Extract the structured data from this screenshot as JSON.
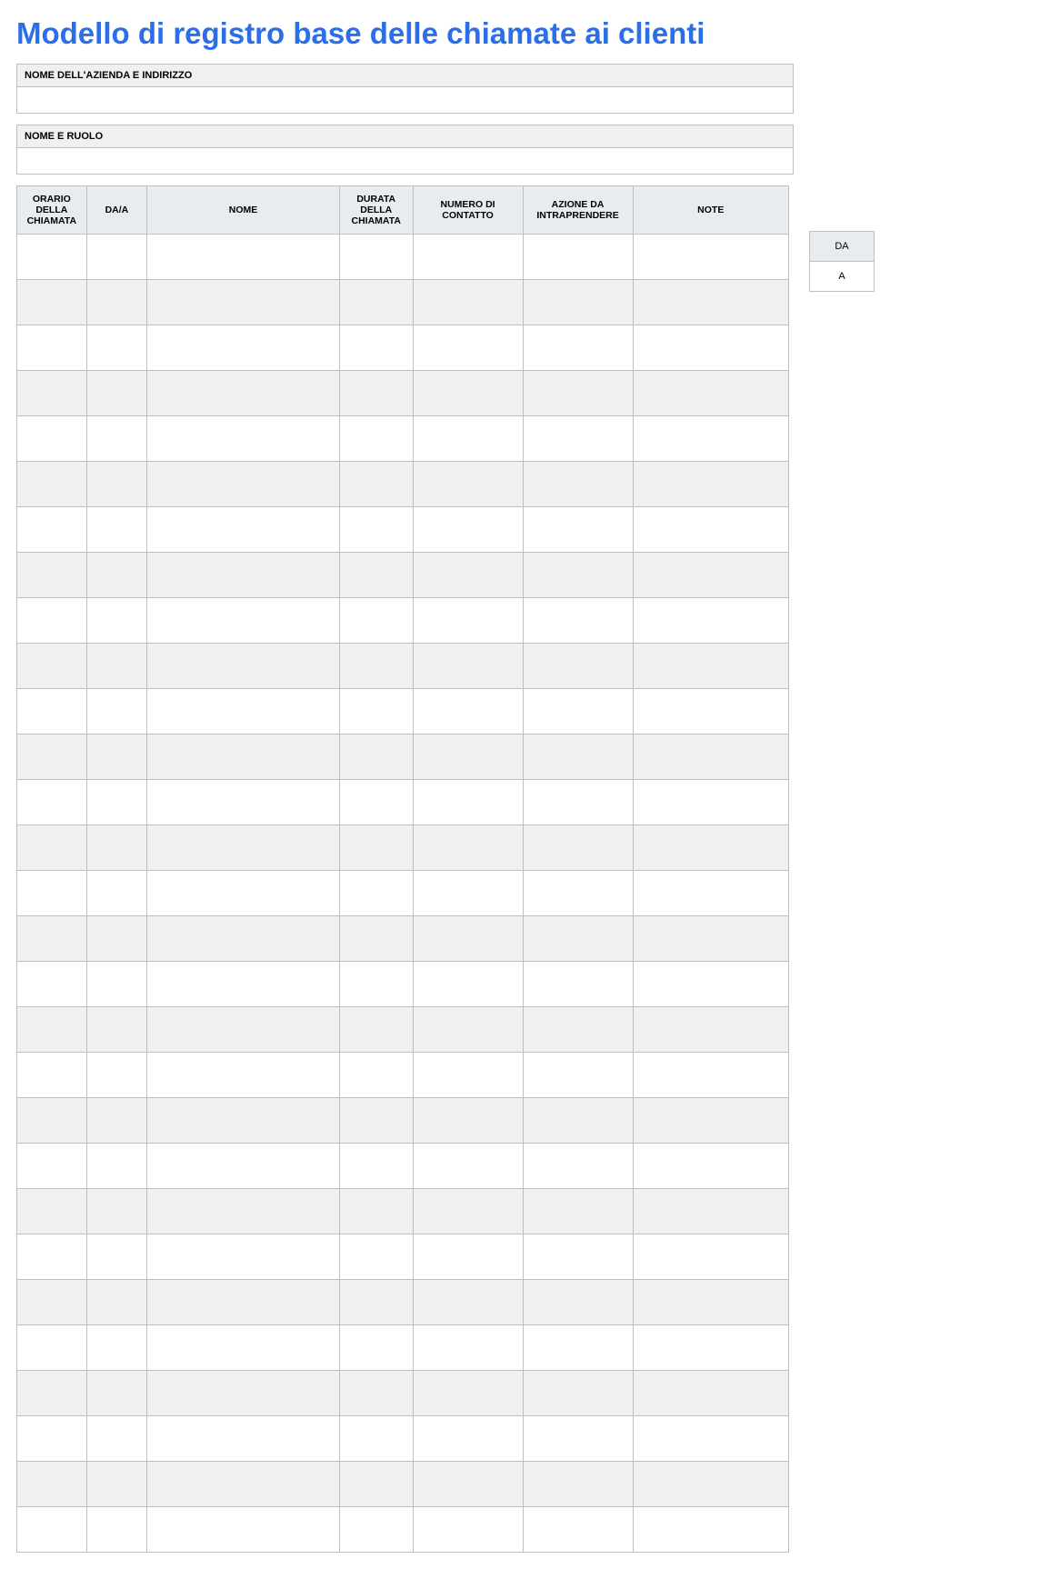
{
  "title": "Modello di registro base delle chiamate ai clienti",
  "info": {
    "company_label": "NOME DELL'AZIENDA E INDIRIZZO",
    "company_value": "",
    "name_role_label": "NOME E RUOLO",
    "name_role_value": ""
  },
  "columns": {
    "time": "ORARIO DELLA CHIAMATA",
    "daa": "DA/A",
    "name": "NOME",
    "dur": "DURATA DELLA CHIAMATA",
    "contact": "NUMERO DI CONTATTO",
    "action": "AZIONE DA INTRAPRENDERE",
    "note": "NOTE"
  },
  "rows": [
    {
      "time": "",
      "daa": "",
      "name": "",
      "dur": "",
      "contact": "",
      "action": "",
      "note": ""
    },
    {
      "time": "",
      "daa": "",
      "name": "",
      "dur": "",
      "contact": "",
      "action": "",
      "note": ""
    },
    {
      "time": "",
      "daa": "",
      "name": "",
      "dur": "",
      "contact": "",
      "action": "",
      "note": ""
    },
    {
      "time": "",
      "daa": "",
      "name": "",
      "dur": "",
      "contact": "",
      "action": "",
      "note": ""
    },
    {
      "time": "",
      "daa": "",
      "name": "",
      "dur": "",
      "contact": "",
      "action": "",
      "note": ""
    },
    {
      "time": "",
      "daa": "",
      "name": "",
      "dur": "",
      "contact": "",
      "action": "",
      "note": ""
    },
    {
      "time": "",
      "daa": "",
      "name": "",
      "dur": "",
      "contact": "",
      "action": "",
      "note": ""
    },
    {
      "time": "",
      "daa": "",
      "name": "",
      "dur": "",
      "contact": "",
      "action": "",
      "note": ""
    },
    {
      "time": "",
      "daa": "",
      "name": "",
      "dur": "",
      "contact": "",
      "action": "",
      "note": ""
    },
    {
      "time": "",
      "daa": "",
      "name": "",
      "dur": "",
      "contact": "",
      "action": "",
      "note": ""
    },
    {
      "time": "",
      "daa": "",
      "name": "",
      "dur": "",
      "contact": "",
      "action": "",
      "note": ""
    },
    {
      "time": "",
      "daa": "",
      "name": "",
      "dur": "",
      "contact": "",
      "action": "",
      "note": ""
    },
    {
      "time": "",
      "daa": "",
      "name": "",
      "dur": "",
      "contact": "",
      "action": "",
      "note": ""
    },
    {
      "time": "",
      "daa": "",
      "name": "",
      "dur": "",
      "contact": "",
      "action": "",
      "note": ""
    },
    {
      "time": "",
      "daa": "",
      "name": "",
      "dur": "",
      "contact": "",
      "action": "",
      "note": ""
    },
    {
      "time": "",
      "daa": "",
      "name": "",
      "dur": "",
      "contact": "",
      "action": "",
      "note": ""
    },
    {
      "time": "",
      "daa": "",
      "name": "",
      "dur": "",
      "contact": "",
      "action": "",
      "note": ""
    },
    {
      "time": "",
      "daa": "",
      "name": "",
      "dur": "",
      "contact": "",
      "action": "",
      "note": ""
    },
    {
      "time": "",
      "daa": "",
      "name": "",
      "dur": "",
      "contact": "",
      "action": "",
      "note": ""
    },
    {
      "time": "",
      "daa": "",
      "name": "",
      "dur": "",
      "contact": "",
      "action": "",
      "note": ""
    },
    {
      "time": "",
      "daa": "",
      "name": "",
      "dur": "",
      "contact": "",
      "action": "",
      "note": ""
    },
    {
      "time": "",
      "daa": "",
      "name": "",
      "dur": "",
      "contact": "",
      "action": "",
      "note": ""
    },
    {
      "time": "",
      "daa": "",
      "name": "",
      "dur": "",
      "contact": "",
      "action": "",
      "note": ""
    },
    {
      "time": "",
      "daa": "",
      "name": "",
      "dur": "",
      "contact": "",
      "action": "",
      "note": ""
    },
    {
      "time": "",
      "daa": "",
      "name": "",
      "dur": "",
      "contact": "",
      "action": "",
      "note": ""
    },
    {
      "time": "",
      "daa": "",
      "name": "",
      "dur": "",
      "contact": "",
      "action": "",
      "note": ""
    },
    {
      "time": "",
      "daa": "",
      "name": "",
      "dur": "",
      "contact": "",
      "action": "",
      "note": ""
    },
    {
      "time": "",
      "daa": "",
      "name": "",
      "dur": "",
      "contact": "",
      "action": "",
      "note": ""
    },
    {
      "time": "",
      "daa": "",
      "name": "",
      "dur": "",
      "contact": "",
      "action": "",
      "note": ""
    }
  ],
  "legend": {
    "head": "DA",
    "body": "A"
  }
}
